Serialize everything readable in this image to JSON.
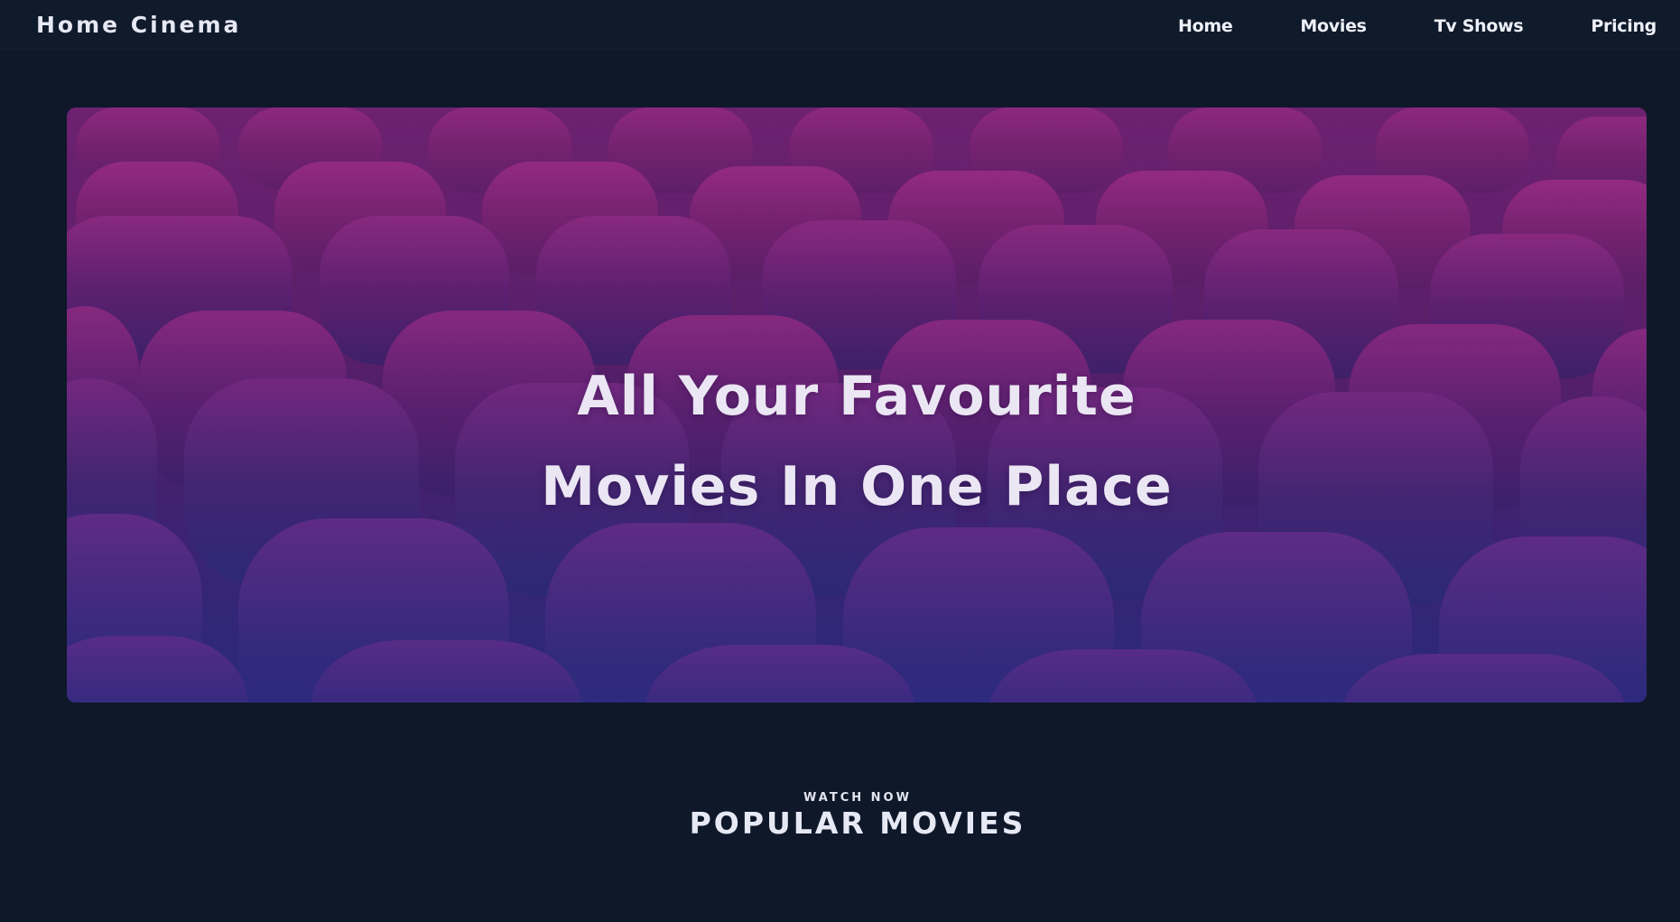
{
  "brand": {
    "name": "Home Cinema"
  },
  "nav": {
    "links": [
      "Home",
      "Movies",
      "Tv Shows",
      "Pricing"
    ]
  },
  "hero": {
    "line1": "All Your Favourite",
    "line2": "Movies In One Place"
  },
  "popular": {
    "eyebrow": "WATCH NOW",
    "title": "POPULAR MOVIES"
  },
  "colors": {
    "background": "#0e1829",
    "text": "#e6e8f4",
    "hero_top": "#6b2270",
    "hero_bottom": "#2b2a78"
  }
}
